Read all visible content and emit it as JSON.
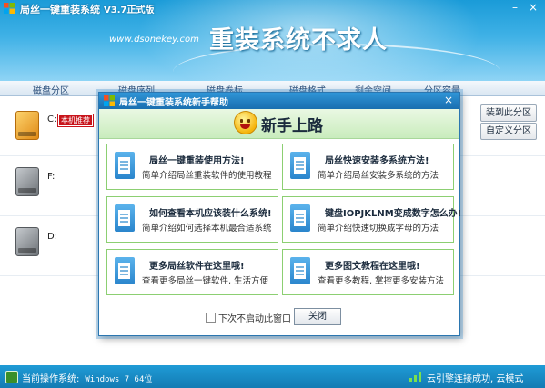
{
  "app": {
    "title": "局丝一键重装系统",
    "version": "V3.7正式版",
    "url": "www.dsonekey.com",
    "slogan": "重装系统不求人",
    "window_buttons": [
      "–",
      "×"
    ]
  },
  "columns": [
    "磁盘分区",
    "磁盘序列",
    "磁盘卷标",
    "磁盘格式",
    "剩余空间",
    "分区容量"
  ],
  "disks": [
    {
      "letter": "C:",
      "badge": "本机推荐",
      "icon_color": "orange"
    },
    {
      "letter": "F:",
      "icon_color": "gray"
    },
    {
      "letter": "D:",
      "icon_color": "gray"
    }
  ],
  "side_buttons": {
    "install": "装到此分区",
    "custom": "自定义分区"
  },
  "status": {
    "label": "当前操作系统:",
    "os": "Windows 7 64位",
    "right": "云引擎连接成功, 云模式"
  },
  "modal": {
    "title": "局丝一键重装系统新手帮助",
    "heading": "新手上路",
    "cards": [
      {
        "title": "局丝一键重装使用方法!",
        "desc": "简单介绍局丝重装软件的使用教程"
      },
      {
        "title": "局丝快速安装多系统方法!",
        "desc": "简单介绍局丝安装多系统的方法"
      },
      {
        "title": "如何查看本机应该装什么系统!",
        "desc": "简单介绍如何选择本机最合适系统"
      },
      {
        "title": "键盘IOPJKLNM变成数字怎么办!",
        "desc": "简单介绍快速切换成字母的方法"
      },
      {
        "title": "更多局丝软件在这里哦!",
        "desc": "查看更多局丝一键软件, 生活方便"
      },
      {
        "title": "更多图文教程在这里哦!",
        "desc": "查看更多教程, 掌控更多安装方法"
      }
    ],
    "dont_show": "下次不启动此窗口",
    "close": "关闭"
  },
  "colors": {
    "accent": "#1a8fd0",
    "card_border": "#8ccf72",
    "badge": "#c8141b"
  }
}
